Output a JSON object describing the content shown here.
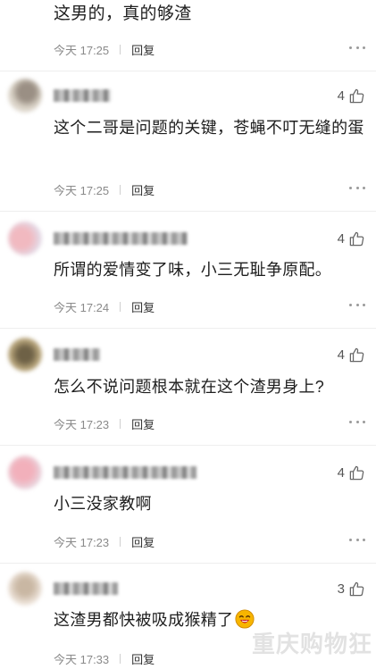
{
  "comments": [
    {
      "text": "这男的，真的够渣",
      "time": "今天 17:25",
      "reply": "回复",
      "likes": ""
    },
    {
      "text": "这个二哥是问题的关键，苍蝇不叮无缝的蛋",
      "time": "今天 17:25",
      "reply": "回复",
      "likes": "4",
      "avatar_colors": [
        "#d9d2c6",
        "#9a8f84"
      ]
    },
    {
      "text": "所谓的爱情变了味，小三无耻争原配。",
      "time": "今天 17:24",
      "reply": "回复",
      "likes": "4",
      "avatar_colors": [
        "#f1b9c0",
        "#e3d9e6"
      ]
    },
    {
      "text": "怎么不说问题根本就在这个渣男身上?",
      "time": "今天 17:23",
      "reply": "回复",
      "likes": "4",
      "avatar_colors": [
        "#8b7a5a",
        "#b7a47a"
      ]
    },
    {
      "text": "小三没家教啊",
      "time": "今天 17:23",
      "reply": "回复",
      "likes": "4",
      "avatar_colors": [
        "#f2b0bb",
        "#e9d7e0"
      ]
    },
    {
      "text": "这渣男都快被吸成猴精了",
      "time": "今天 17:33",
      "reply": "回复",
      "likes": "3",
      "avatar_colors": [
        "#ece2d8",
        "#c9b7a3"
      ]
    }
  ],
  "watermark": "重庆购物狂",
  "icons": {
    "like": "thumbs-up-icon",
    "more": "more-options-icon",
    "emoji": "laughing-emoji-icon"
  }
}
